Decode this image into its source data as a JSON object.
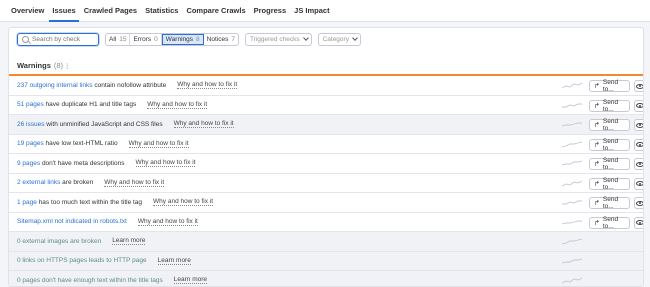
{
  "tabs": [
    "Overview",
    "Issues",
    "Crawled Pages",
    "Statistics",
    "Compare Crawls",
    "Progress",
    "JS Impact"
  ],
  "active_tab": "Issues",
  "filters": {
    "search_placeholder": "Search by check",
    "all_label": "All",
    "all_count": "15",
    "errors_label": "Errors",
    "errors_count": "0",
    "warnings_label": "Warnings",
    "warnings_count": "8",
    "notices_label": "Notices",
    "notices_count": "7",
    "triggered_label": "Triggered checks",
    "category_label": "Category"
  },
  "section": {
    "title": "Warnings",
    "count": "(8)"
  },
  "send_label": "Send to...",
  "rows": [
    {
      "link": "237 outgoing internal links",
      "rest": " contain nofollow attribute",
      "why": "Why and how to fix it",
      "style": "blue",
      "shaded": false,
      "actions": true
    },
    {
      "link": "51 pages",
      "rest": " have duplicate H1 and title tags",
      "why": "Why and how to fix it",
      "style": "blue",
      "shaded": false,
      "actions": true
    },
    {
      "link": "26 issues",
      "rest": " with unminified JavaScript and CSS files",
      "why": "Why and how to fix it",
      "style": "blue",
      "shaded": true,
      "actions": true
    },
    {
      "link": "19 pages",
      "rest": " have low text-HTML ratio",
      "why": "Why and how to fix it",
      "style": "blue",
      "shaded": false,
      "actions": true
    },
    {
      "link": "9 pages",
      "rest": " don't have meta descriptions",
      "why": "Why and how to fix it",
      "style": "blue",
      "shaded": false,
      "actions": true
    },
    {
      "link": "2 external links",
      "rest": " are broken",
      "why": "Why and how to fix it",
      "style": "blue",
      "shaded": false,
      "actions": true
    },
    {
      "link": "1 page",
      "rest": " has too much text within the title tag",
      "why": "Why and how to fix it",
      "style": "blue",
      "shaded": false,
      "actions": true
    },
    {
      "link": "Sitemap.xml not indicated in robots.txt",
      "rest": "",
      "why": "Why and how to fix it",
      "style": "blue",
      "shaded": false,
      "actions": true
    },
    {
      "link": "0 external images are broken",
      "rest": "",
      "why": "Learn more",
      "style": "gray",
      "shaded": true,
      "actions": false
    },
    {
      "link": "0 links on HTTPS pages leads to HTTP page",
      "rest": "",
      "why": "Learn more",
      "style": "gray",
      "shaded": true,
      "actions": false
    },
    {
      "link": "0 pages don't have enough text within the title tags",
      "rest": "",
      "why": "Learn more",
      "style": "gray",
      "shaded": true,
      "actions": false
    }
  ],
  "colors": {
    "accent": "#2b6fd6",
    "warning_bar": "#f08a2c",
    "muted_text": "#5b8e8b"
  }
}
